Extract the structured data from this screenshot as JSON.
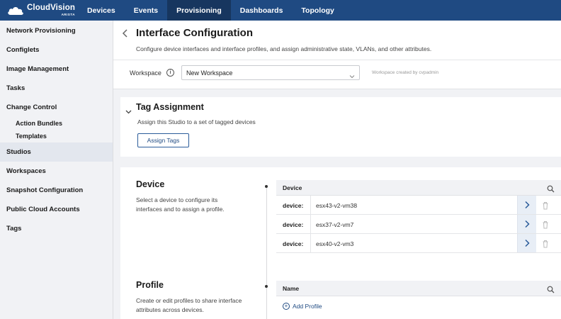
{
  "app": {
    "logo_main": "CloudVision",
    "logo_sub": "ARISTA"
  },
  "nav": {
    "items": [
      {
        "label": "Devices",
        "active": false
      },
      {
        "label": "Events",
        "active": false
      },
      {
        "label": "Provisioning",
        "active": true
      },
      {
        "label": "Dashboards",
        "active": false
      },
      {
        "label": "Topology",
        "active": false
      }
    ]
  },
  "sidebar": {
    "items": [
      {
        "label": "Network Provisioning"
      },
      {
        "label": "Configlets"
      },
      {
        "label": "Image Management"
      },
      {
        "label": "Tasks"
      },
      {
        "label": "Change Control"
      },
      {
        "label": "Action Bundles"
      },
      {
        "label": "Templates"
      },
      {
        "label": "Studios"
      },
      {
        "label": "Workspaces"
      },
      {
        "label": "Snapshot Configuration"
      },
      {
        "label": "Public Cloud Accounts"
      },
      {
        "label": "Tags"
      }
    ]
  },
  "header": {
    "title": "Interface Configuration",
    "description": "Configure device interfaces and interface profiles, and assign administrative state, VLANs, and other attributes."
  },
  "workspace": {
    "label": "Workspace",
    "selected": "New Workspace",
    "note": "Workspace created by cvpadmin"
  },
  "tag_assignment": {
    "title": "Tag Assignment",
    "description": "Assign this Studio to a set of tagged devices",
    "button": "Assign Tags"
  },
  "device_section": {
    "title": "Device",
    "description": "Select a device to configure its interfaces and to assign a profile.",
    "table_header": "Device",
    "rows": [
      {
        "key": "device:",
        "value": "esx43-v2-vm38"
      },
      {
        "key": "device:",
        "value": "esx37-v2-vm7"
      },
      {
        "key": "device:",
        "value": "esx40-v2-vm3"
      }
    ]
  },
  "profile_section": {
    "title": "Profile",
    "description": "Create or edit profiles to share interface attributes across devices.",
    "table_header": "Name",
    "add_label": "Add Profile"
  },
  "colors": {
    "nav_bg": "#1f4a82",
    "nav_active": "#17365f",
    "accent": "#1f4a82"
  },
  "icons": [
    "cloud-logo-icon",
    "back-chevron-icon",
    "info-icon",
    "chevron-down-icon",
    "search-icon",
    "chevron-right-icon",
    "trash-icon",
    "plus-circle-icon"
  ]
}
